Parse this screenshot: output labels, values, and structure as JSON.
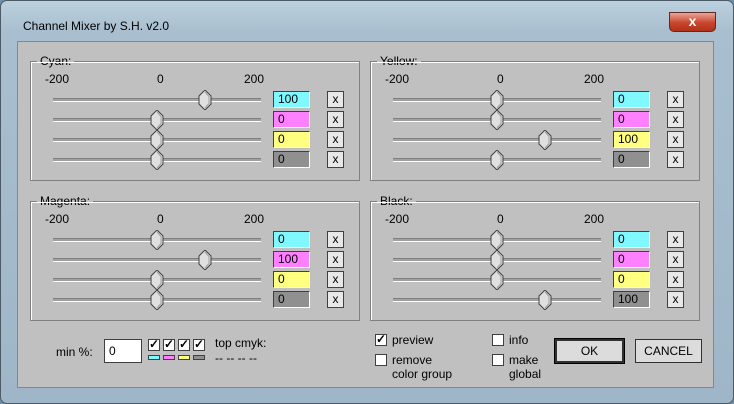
{
  "window": {
    "title": "Channel Mixer by S.H. v2.0",
    "close_glyph": "x"
  },
  "scale": {
    "min": "-200",
    "mid": "0",
    "max": "200"
  },
  "colors": {
    "cyan": "#7ff8ff",
    "magenta": "#ff80ff",
    "yellow": "#ffff80",
    "black": "#909090"
  },
  "groups": [
    {
      "id": "cyan",
      "label": "Cyan:",
      "values": [
        "100",
        "0",
        "0",
        "0"
      ],
      "levels": [
        100,
        0,
        0,
        0
      ]
    },
    {
      "id": "yellow",
      "label": "Yellow:",
      "values": [
        "0",
        "0",
        "100",
        "0"
      ],
      "levels": [
        0,
        0,
        100,
        0
      ]
    },
    {
      "id": "magenta",
      "label": "Magenta:",
      "values": [
        "0",
        "100",
        "0",
        "0"
      ],
      "levels": [
        0,
        100,
        0,
        0
      ]
    },
    {
      "id": "black",
      "label": "Black:",
      "values": [
        "0",
        "0",
        "0",
        "100"
      ],
      "levels": [
        0,
        0,
        0,
        100
      ]
    }
  ],
  "reset_label": "x",
  "min_percent": {
    "label": "min %:",
    "value": "0"
  },
  "channel_checks": {
    "checked": [
      true,
      true,
      true,
      true
    ]
  },
  "top_cmyk": {
    "label": "top cmyk:",
    "value": "-- -- -- --"
  },
  "options": {
    "preview": {
      "label": "preview",
      "checked": true
    },
    "remove_color_group": {
      "label_line1": "remove",
      "label_line2": "color group",
      "checked": false
    },
    "info": {
      "label": "info",
      "checked": false
    },
    "make_global": {
      "label_line1": "make",
      "label_line2": "global",
      "checked": false
    }
  },
  "buttons": {
    "ok": "OK",
    "cancel": "CANCEL"
  }
}
